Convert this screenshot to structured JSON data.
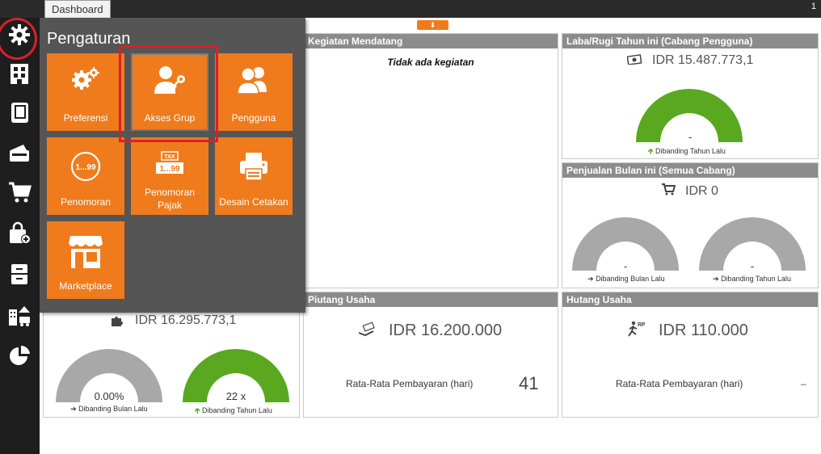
{
  "topbar": {
    "tab_label": "Dashboard",
    "counter": "1",
    "collapse_arrow": "⬇"
  },
  "sidebar": {
    "items": [
      {
        "icon": "gear-icon"
      },
      {
        "icon": "building-icon"
      },
      {
        "icon": "book-icon"
      },
      {
        "icon": "wallet-icon"
      },
      {
        "icon": "cart-icon"
      },
      {
        "icon": "bag-add-icon"
      },
      {
        "icon": "cabinet-icon"
      },
      {
        "icon": "building-truck-icon"
      },
      {
        "icon": "pie-chart-icon"
      }
    ]
  },
  "settings_menu": {
    "title": "Pengaturan",
    "tiles": [
      {
        "label": "Preferensi",
        "icon": "gears-icon"
      },
      {
        "label": "Akses Grup",
        "icon": "user-key-icon"
      },
      {
        "label": "Pengguna",
        "icon": "users-icon"
      },
      {
        "label": "Penomoran",
        "icon": "numbering-icon",
        "badge": "1...99"
      },
      {
        "label_line1": "Penomoran",
        "label_line2": "Pajak",
        "icon": "tax-numbering-icon",
        "badge_top": "TAX",
        "badge": "1...99"
      },
      {
        "label": "Desain Cetakan",
        "icon": "printer-icon"
      },
      {
        "label": "Marketplace",
        "icon": "store-icon"
      }
    ]
  },
  "panels": {
    "upcoming": {
      "title": "Kegiatan Mendatang",
      "empty_text": "Tidak ada kegiatan"
    },
    "profit": {
      "title": "Laba/Rugi Tahun ini (Cabang Pengguna)",
      "amount": "IDR 15.487.773,1",
      "gauge_value": "-",
      "compare_label": "Dibanding Tahun Lalu",
      "gauge_fill": 1.0,
      "gauge_color": "#5aa820"
    },
    "sales": {
      "title": "Penjualan Bulan ini (Semua Cabang)",
      "amount": "IDR 0",
      "gauge_left_value": "-",
      "gauge_left_label": "Dibanding Bulan Lalu",
      "gauge_right_value": "-",
      "gauge_right_label": "Dibanding Tahun Lalu",
      "gauge_color": "#a8a8a8"
    },
    "inventory": {
      "amount": "IDR 16.295.773,1",
      "gauge_left_value": "0.00%",
      "gauge_left_label": "Dibanding Bulan Lalu",
      "gauge_right_value": "22 x",
      "gauge_right_label": "Dibanding Tahun Lalu",
      "gauge_left_color": "#a8a8a8",
      "gauge_right_color": "#5aa820"
    },
    "receivables": {
      "title": "Piutang Usaha",
      "amount": "IDR 16.200.000",
      "avg_label": "Rata-Rata Pembayaran (hari)",
      "avg_value": "41"
    },
    "payables": {
      "title": "Hutang Usaha",
      "amount": "IDR 110.000",
      "avg_label": "Rata-Rata Pembayaran (hari)",
      "avg_value": "–"
    }
  },
  "icons": {
    "money_icon": "money-icon",
    "cart_small_icon": "cart-icon",
    "puzzle_icon": "puzzle-icon",
    "hand_money_icon": "hand-money-icon",
    "runner_icon": "running-rp-icon"
  }
}
